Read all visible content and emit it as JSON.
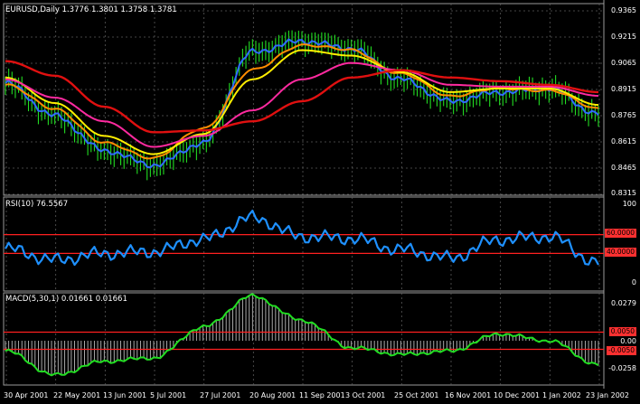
{
  "price_panel": {
    "title": "EURUSD,Daily  1.3776 1.3801 1.3758 1.3781",
    "y_ticks": [
      "0.9365",
      "0.9215",
      "0.9065",
      "0.8915",
      "0.8765",
      "0.8615",
      "0.8465",
      "0.8315"
    ]
  },
  "rsi_panel": {
    "title": "RSI(10) 76.5567",
    "y_ticks": [
      "100",
      "0"
    ],
    "level_high_label": "60.0000",
    "level_low_label": "40.0000"
  },
  "macd_panel": {
    "title": "MACD(5,30,1) 0.01661 0.01661",
    "y_ticks": [
      "0.0279",
      "0.00"
    ],
    "level_high_label": "0.0050",
    "level_low_label": "-0.0050",
    "bottom_label": "-0.0258"
  },
  "x_axis": {
    "ticks": [
      "30 Apr 2001",
      "22 May 2001",
      "13 Jun 2001",
      "5 Jul 2001",
      "27 Jul 2001",
      "20 Aug 2001",
      "11 Sep 2001",
      "3 Oct 2001",
      "25 Oct 2001",
      "16 Nov 2001",
      "10 Dec 2001",
      "1 Jan 2002",
      "23 Jan 2002"
    ]
  },
  "colors": {
    "background": "#000000",
    "grid": "#5a5a5a",
    "candles": "#22dd22",
    "price_line": "#2f6cff",
    "ma_fast": "#ff8c00",
    "ma_yellow": "#ffee00",
    "ma_pink": "#ff2aa0",
    "ma_red": "#e01010",
    "rsi_line": "#1e90ff",
    "level_line": "#ff2020",
    "macd_hist": "#bbbbbb",
    "macd_signal": "#22dd22"
  },
  "chart_data": [
    {
      "type": "line",
      "title": "EURUSD,Daily",
      "x": [
        "30 Apr 2001",
        "22 May 2001",
        "13 Jun 2001",
        "5 Jul 2001",
        "27 Jul 2001",
        "20 Aug 2001",
        "11 Sep 2001",
        "3 Oct 2001",
        "25 Oct 2001",
        "16 Nov 2001",
        "10 Dec 2001",
        "1 Jan 2002",
        "23 Jan 2002"
      ],
      "ylim": [
        0.8315,
        0.9365
      ],
      "series": [
        {
          "values": [
            0.893,
            0.875,
            0.856,
            0.848,
            0.86,
            0.91,
            0.916,
            0.912,
            0.895,
            0.883,
            0.888,
            0.89,
            0.876
          ]
        },
        {
          "values": [
            0.892,
            0.879,
            0.86,
            0.852,
            0.868,
            0.9,
            0.914,
            0.911,
            0.898,
            0.886,
            0.89,
            0.889,
            0.879
          ]
        },
        {
          "values": [
            0.896,
            0.882,
            0.864,
            0.854,
            0.865,
            0.895,
            0.911,
            0.908,
            0.899,
            0.888,
            0.89,
            0.89,
            0.881
          ]
        },
        {
          "values": [
            0.895,
            0.885,
            0.872,
            0.858,
            0.864,
            0.878,
            0.895,
            0.904,
            0.9,
            0.892,
            0.891,
            0.891,
            0.886
          ]
        },
        {
          "values": [
            0.905,
            0.897,
            0.88,
            0.866,
            0.867,
            0.872,
            0.883,
            0.896,
            0.9,
            0.896,
            0.894,
            0.892,
            0.888
          ]
        }
      ]
    },
    {
      "type": "line",
      "title": "RSI(10) 76.5567",
      "x": [
        "30 Apr 2001",
        "22 May 2001",
        "13 Jun 2001",
        "5 Jul 2001",
        "27 Jul 2001",
        "20 Aug 2001",
        "11 Sep 2001",
        "3 Oct 2001",
        "25 Oct 2001",
        "16 Nov 2001",
        "10 Dec 2001",
        "1 Jan 2002",
        "23 Jan 2002"
      ],
      "ylim": [
        0,
        100
      ],
      "levels": [
        60,
        40
      ],
      "series": [
        {
          "values": [
            45,
            33,
            40,
            42,
            55,
            78,
            58,
            56,
            44,
            35,
            55,
            58,
            30
          ]
        }
      ]
    },
    {
      "type": "bar",
      "title": "MACD(5,30,1) 0.01661 0.01661",
      "categories": [
        "30 Apr 2001",
        "22 May 2001",
        "13 Jun 2001",
        "5 Jul 2001",
        "27 Jul 2001",
        "20 Aug 2001",
        "11 Sep 2001",
        "3 Oct 2001",
        "25 Oct 2001",
        "16 Nov 2001",
        "10 Dec 2001",
        "1 Jan 2002",
        "23 Jan 2002"
      ],
      "ylim": [
        -0.0258,
        0.0279
      ],
      "levels": [
        0.005,
        -0.005
      ],
      "series": [
        {
          "values": [
            -0.006,
            -0.02,
            -0.012,
            -0.01,
            0.008,
            0.026,
            0.012,
            -0.004,
            -0.008,
            -0.006,
            0.004,
            0.0,
            -0.014
          ]
        }
      ]
    }
  ]
}
